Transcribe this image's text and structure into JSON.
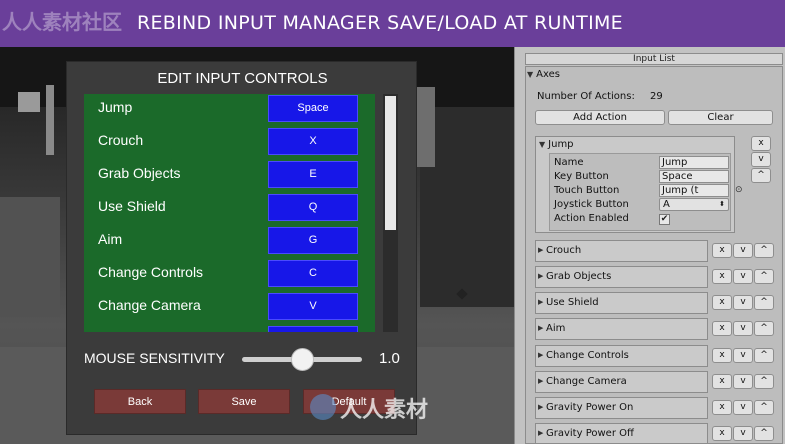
{
  "banner": {
    "title": "REBIND INPUT MANAGER SAVE/LOAD AT RUNTIME",
    "watermark": "人人素材社区"
  },
  "dialog": {
    "title": "EDIT INPUT CONTROLS",
    "controls": [
      {
        "label": "Jump",
        "key": "Space"
      },
      {
        "label": "Crouch",
        "key": "X"
      },
      {
        "label": "Grab Objects",
        "key": "E"
      },
      {
        "label": "Use Shield",
        "key": "Q"
      },
      {
        "label": "Aim",
        "key": "G"
      },
      {
        "label": "Change Controls",
        "key": "C"
      },
      {
        "label": "Change Camera",
        "key": "V"
      }
    ],
    "scroll_position": 0.0,
    "mouse_sensitivity": {
      "label": "MOUSE SENSITIVITY",
      "value": "1.0",
      "slider_fraction": 0.5
    },
    "buttons": {
      "back": "Back",
      "save": "Save",
      "default": "Default"
    },
    "watermark": "人人素材"
  },
  "inspector": {
    "header": "Input List",
    "axes": {
      "title": "Axes",
      "num_actions_label": "Number Of Actions:",
      "num_actions_value": "29"
    },
    "add_action": "Add Action",
    "clear": "Clear",
    "side_buttons": {
      "remove": "x",
      "down": "v",
      "up": "^"
    },
    "jump": {
      "title": "Jump",
      "fields": [
        {
          "label": "Name",
          "value": "Jump"
        },
        {
          "label": "Key Button",
          "value": "Space"
        },
        {
          "label": "Touch Button",
          "value": "Jump (t"
        },
        {
          "label": "Joystick Button",
          "value": "A"
        },
        {
          "label": "Action Enabled",
          "value": "✔"
        }
      ]
    },
    "actions": [
      "Crouch",
      "Grab Objects",
      "Use Shield",
      "Aim",
      "Change Controls",
      "Change Camera",
      "Gravity Power On",
      "Gravity Power Off"
    ]
  },
  "colors": {
    "banner": "#6a3f9a",
    "list_bg": "#1b6a2a",
    "key_button": "#1717e8",
    "dialog_button": "#7a3a38"
  }
}
